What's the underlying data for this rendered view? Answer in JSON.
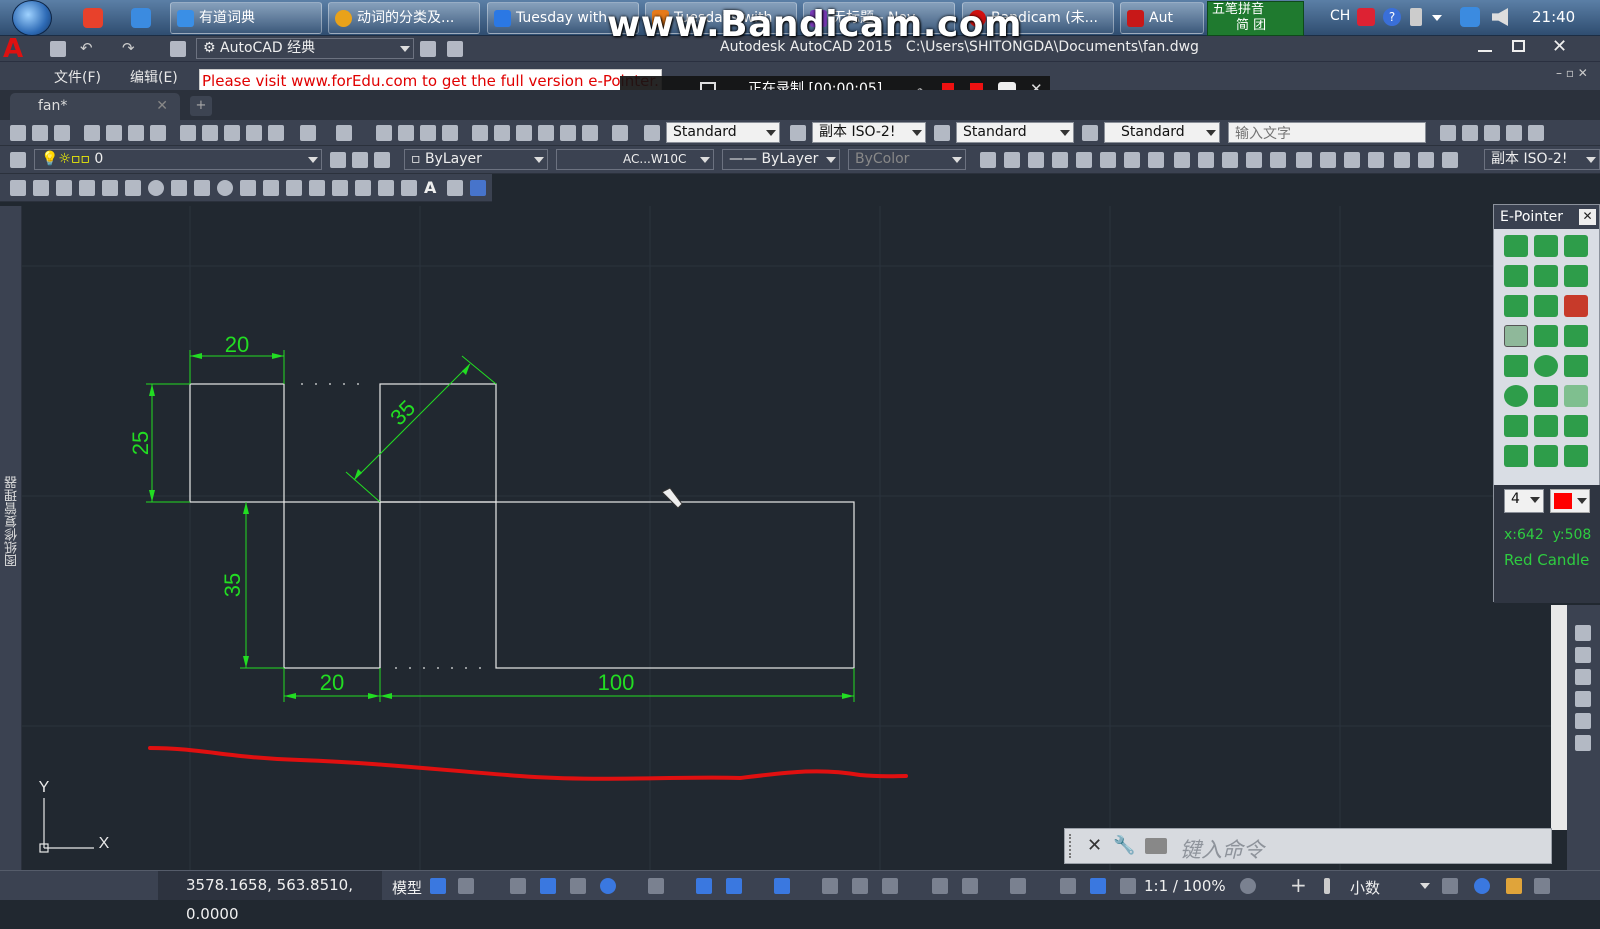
{
  "taskbar": {
    "tasks": [
      {
        "label": "有道词典",
        "color": "#3a8fe6"
      },
      {
        "label": "动词的分类及...",
        "color": "#e9a21a"
      },
      {
        "label": "Tuesday with",
        "color": "#2b78e4"
      },
      {
        "label": "Tuesdays with",
        "color": "#e67a1a"
      },
      {
        "label": "无标题 - Nov",
        "color": "#7a3ab8"
      },
      {
        "label": "Bandicam (未...",
        "color": "#d01010"
      },
      {
        "label": "Aut",
        "color": "#c81818"
      }
    ],
    "ime": {
      "line1": "五笔拼音",
      "line2": "简 团"
    },
    "lang": "CH",
    "clock": "21:40"
  },
  "watermark": "www.Bandicam.com",
  "title": {
    "workspace": "AutoCAD 经典",
    "window_title": "Autodesk AutoCAD 2015   C:\\Users\\SHITONGDA\\Documents\\fan.dwg"
  },
  "menu": {
    "items": [
      "文件(F)",
      "编辑(E)"
    ],
    "notice": "Please visit www.forEdu.com to get the full version e-Pointer."
  },
  "recorder": {
    "label": "正在录制 [00:00:05]"
  },
  "tabs": {
    "active": "fan*"
  },
  "toolbar1": {
    "text_style": "Standard",
    "dim_style": "副本 ISO-2!",
    "table_style": "Standard",
    "mleader_style": "Standard",
    "search_placeholder": "输入文字"
  },
  "toolbar2": {
    "layer": "0",
    "color": "ByLayer",
    "linetype": "AC...W10C",
    "lineweight": "ByLayer",
    "plotstyle": "ByColor",
    "dimstyle_right": "副本 ISO-2!"
  },
  "palette": {
    "label": "图纸修复管理器"
  },
  "epointer": {
    "title": "E-Pointer",
    "size": "4",
    "color": "#ff0000",
    "coords": "x:642  y:508",
    "color_name": "Red Candle"
  },
  "drawing": {
    "dims": {
      "top_width": "20",
      "left_height": "25",
      "diagonal": "35",
      "lower_height": "35",
      "bottom_width": "20",
      "bottom_length": "100"
    },
    "ucs": {
      "x": "X",
      "y": "Y"
    },
    "line_color": "#e8e8e8",
    "dim_color": "#22dd22",
    "stroke_color": "#e01010"
  },
  "command": {
    "placeholder": "键入命令"
  },
  "status": {
    "coords": "3578.1658, 563.8510, 0.0000",
    "model": "模型",
    "scale": "1:1 / 100%",
    "units": "小数"
  }
}
